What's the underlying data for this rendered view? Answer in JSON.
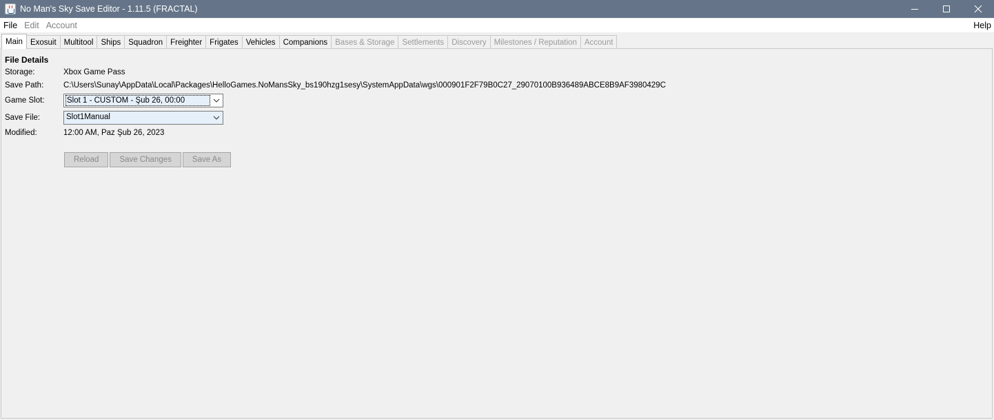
{
  "window": {
    "title": "No Man's Sky Save Editor - 1.11.5 (FRACTAL)",
    "icon": "java-cup-icon",
    "controls": [
      "minimize-icon",
      "maximize-icon",
      "close-icon"
    ]
  },
  "menu": {
    "items": [
      {
        "label": "File",
        "enabled": true
      },
      {
        "label": "Edit",
        "enabled": false
      },
      {
        "label": "Account",
        "enabled": false
      }
    ],
    "help": "Help"
  },
  "tabs": [
    {
      "label": "Main",
      "active": true,
      "enabled": true
    },
    {
      "label": "Exosuit",
      "enabled": true
    },
    {
      "label": "Multitool",
      "enabled": true
    },
    {
      "label": "Ships",
      "enabled": true
    },
    {
      "label": "Squadron",
      "enabled": true
    },
    {
      "label": "Freighter",
      "enabled": true
    },
    {
      "label": "Frigates",
      "enabled": true
    },
    {
      "label": "Vehicles",
      "enabled": true
    },
    {
      "label": "Companions",
      "enabled": true
    },
    {
      "label": "Bases & Storage",
      "enabled": false
    },
    {
      "label": "Settlements",
      "enabled": false
    },
    {
      "label": "Discovery",
      "enabled": false
    },
    {
      "label": "Milestones / Reputation",
      "enabled": false
    },
    {
      "label": "Account",
      "enabled": false
    }
  ],
  "file_details": {
    "heading": "File Details",
    "storage_label": "Storage:",
    "storage_value": "Xbox Game Pass",
    "save_path_label": "Save Path:",
    "save_path_value": "C:\\Users\\Sunay\\AppData\\Local\\Packages\\HelloGames.NoMansSky_bs190hzg1sesy\\SystemAppData\\wgs\\000901F2F79B0C27_29070100B936489ABCE8B9AF3980429C",
    "game_slot_label": "Game Slot:",
    "game_slot_value": "Slot 1 - CUSTOM - Şub 26, 00:00",
    "save_file_label": "Save File:",
    "save_file_value": "Slot1Manual",
    "modified_label": "Modified:",
    "modified_value": "12:00 AM, Paz Şub 26, 2023"
  },
  "buttons": {
    "reload": "Reload",
    "save_changes": "Save Changes",
    "save_as": "Save As"
  },
  "colors": {
    "titlebar": "#657488",
    "combo_highlight": "#e6f0fa",
    "disabled_text": "#9a9a9a"
  }
}
